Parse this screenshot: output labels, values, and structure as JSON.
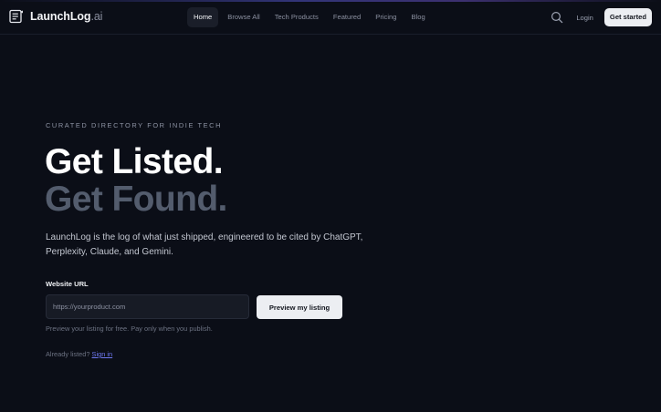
{
  "brand": {
    "name": "LaunchLog",
    "suffix": ".ai"
  },
  "nav": {
    "items": [
      {
        "label": "Home",
        "active": true
      },
      {
        "label": "Browse All",
        "active": false
      },
      {
        "label": "Tech Products",
        "active": false
      },
      {
        "label": "Featured",
        "active": false
      },
      {
        "label": "Pricing",
        "active": false
      },
      {
        "label": "Blog",
        "active": false
      }
    ]
  },
  "header": {
    "search_icon": "search-icon",
    "login_label": "Login",
    "cta_label": "Get started"
  },
  "hero": {
    "eyebrow": "CURATED DIRECTORY FOR INDIE TECH",
    "headline_line1": "Get Listed.",
    "headline_line2": "Get Found.",
    "description": "LaunchLog is the log of what just shipped, engineered to be cited by ChatGPT, Perplexity, Claude, and Gemini."
  },
  "form": {
    "label": "Website URL",
    "input_value": "",
    "placeholder": "https://yourproduct.com",
    "submit_label": "Preview my listing",
    "helper": "Preview your listing for free. Pay only when you publish.",
    "already_listed": "Already listed?",
    "signin_label": "Sign in"
  },
  "colors": {
    "background": "#0b0e17",
    "headline_primary": "#ffffff",
    "headline_secondary": "#535c6d",
    "link": "#6f79f2",
    "button_bg": "#eceef2"
  }
}
